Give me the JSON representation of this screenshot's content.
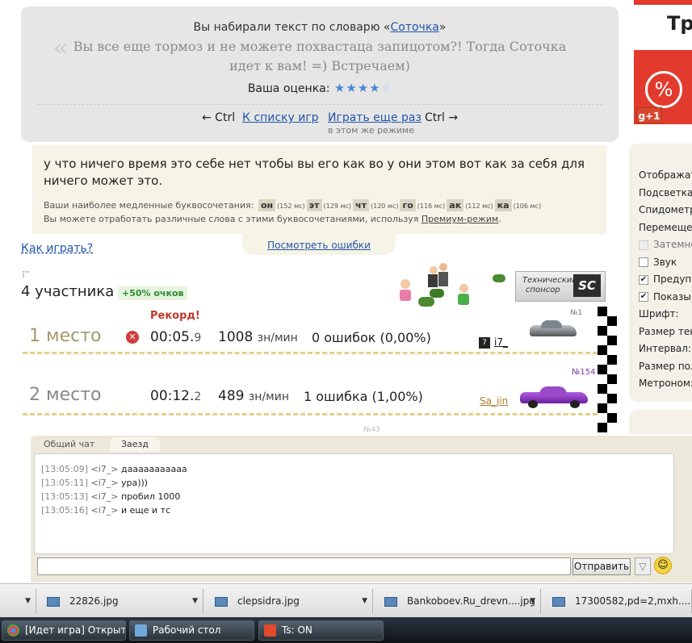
{
  "result": {
    "dict_prefix": "Вы набирали текст по словарю «",
    "dict_name": "Соточка",
    "dict_suffix": "»",
    "quote": "Вы все еще тормоз и не можете похвастаца запицотом?! Тогда Соточка идет к вам! =) Встречаем)",
    "rating_label": "Ваша оценка:",
    "rating_value": 4,
    "rating_max": 5,
    "nav_back_key": "← Ctrl",
    "nav_back": "К списку игр",
    "nav_again": "Играть еще раз",
    "nav_again_sub": "в этом же режиме",
    "nav_fwd_key": "Ctrl →"
  },
  "text_panel": {
    "typed_text": "у что ничего время это себе нет чтобы вы его как во у они этом вот как за себя для ничего может это.",
    "slow_label": "Ваши наиболее медленные буквосочетания:",
    "bigrams": [
      {
        "text": "он",
        "ms": "(152 мс)"
      },
      {
        "text": "эт",
        "ms": "(129 мс)"
      },
      {
        "text": "чт",
        "ms": "(120 мс)"
      },
      {
        "text": "го",
        "ms": "(116 мс)"
      },
      {
        "text": "ак",
        "ms": "(112 мс)"
      },
      {
        "text": "ка",
        "ms": "(106 мс)"
      }
    ],
    "premium_text": "Вы можете отработать различные слова с этими буквосочетаниями, используя ",
    "premium_link": "Премиум-режим",
    "premium_end": ".",
    "show_errors": "Посмотреть ошибки"
  },
  "howto": "Как играть?",
  "participants": {
    "count_label": "4 участника",
    "bonus": "+50% очков",
    "record": "Рекорд!",
    "rows": [
      {
        "place": "1 место",
        "time_main": "00:05.",
        "time_frac": "9",
        "speed": "1008",
        "speed_unit": "зн/мин",
        "errors": "0 ошибок (0,00%)",
        "rank": "№1",
        "nick": "i7_",
        "level": "7"
      },
      {
        "place": "2 место",
        "time_main": "00:12.",
        "time_frac": "2",
        "speed": "489",
        "speed_unit": "зн/мин",
        "errors": "1 ошибка (1,00%)",
        "rank": "№154",
        "nick": "Sa_jin"
      }
    ],
    "next_rank": "№43"
  },
  "sponsor": {
    "line1": "Технический",
    "line2": "спонсор",
    "logo": "SC"
  },
  "promo": {
    "title": "Тр",
    "pct": "%",
    "gplus": "g+1"
  },
  "settings": [
    {
      "label": "Отображат",
      "checkbox": null
    },
    {
      "label": "Подсветка -",
      "checkbox": null
    },
    {
      "label": "Спидометр",
      "checkbox": null
    },
    {
      "label": "Перемещен",
      "checkbox": null
    },
    {
      "label": "Затемне",
      "checkbox": "disabled"
    },
    {
      "label": "Звук",
      "checkbox": "off"
    },
    {
      "label": "Предупр",
      "checkbox": "on"
    },
    {
      "label": "Показыв",
      "checkbox": "on"
    },
    {
      "label": "Шрифт:",
      "checkbox": null
    },
    {
      "label": "Размер тек",
      "checkbox": null
    },
    {
      "label": "Интервал:",
      "checkbox": null
    },
    {
      "label": "Размер пол",
      "checkbox": null
    },
    {
      "label": "Метроном:",
      "checkbox": null
    }
  ],
  "chat": {
    "tab_general": "Общий чат",
    "tab_race": "Заезд",
    "messages": [
      {
        "time": "[13:05:09]",
        "nick": "<i7_>",
        "text": "дааааааааааа"
      },
      {
        "time": "[13:05:11]",
        "nick": "<i7_>",
        "text": "ура)))"
      },
      {
        "time": "[13:05:13]",
        "nick": "<i7_>",
        "text": "пробил 1000"
      },
      {
        "time": "[13:05:16]",
        "nick": "<i7_>",
        "text": "и еще и тс"
      }
    ],
    "input_value": "",
    "send_label": "Отправить"
  },
  "downloads": [
    {
      "name": "22826.jpg"
    },
    {
      "name": "clepsidra.jpg"
    },
    {
      "name": "Bankoboev.Ru_drevn....jpg"
    },
    {
      "name": "17300582,pd=2,mxh...."
    }
  ],
  "taskbar": [
    {
      "label": "[Идет игра] Открыт..."
    },
    {
      "label": "Рабочий стол"
    },
    {
      "label": "Ts: ON"
    }
  ]
}
